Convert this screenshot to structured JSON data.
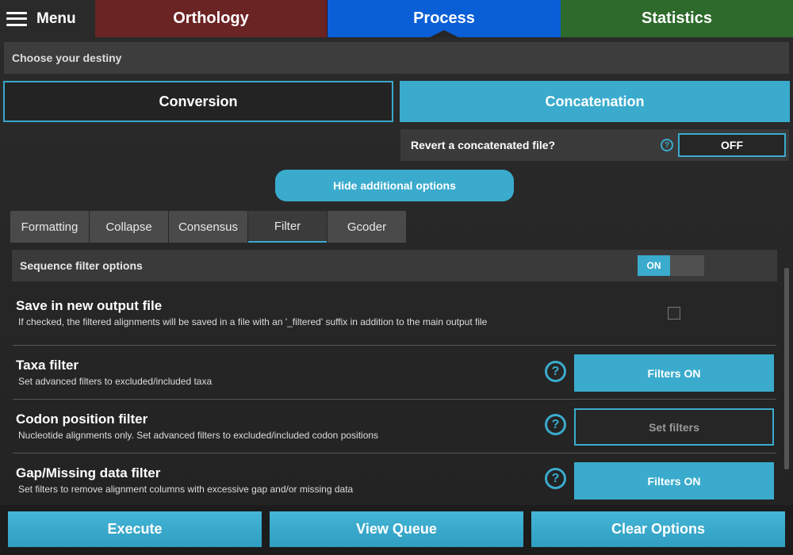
{
  "topbar": {
    "menu_label": "Menu",
    "tabs": [
      {
        "label": "Orthology",
        "color": "#6b2424"
      },
      {
        "label": "Process",
        "color": "#0a5fd6"
      },
      {
        "label": "Statistics",
        "color": "#2e6a2b"
      }
    ],
    "active_tab": "Process"
  },
  "destiny": {
    "label": "Choose your destiny"
  },
  "modes": {
    "conversion": "Conversion",
    "concatenation": "Concatenation",
    "selected": "Concatenation"
  },
  "revert": {
    "label": "Revert a concatenated file?",
    "help_icon": "?",
    "value": "OFF"
  },
  "hide_options_label": "Hide additional options",
  "subtabs": {
    "items": [
      "Formatting",
      "Collapse",
      "Consensus",
      "Filter",
      "Gcoder"
    ],
    "active": "Filter"
  },
  "sequence_filter": {
    "label": "Sequence filter options",
    "toggle": "ON"
  },
  "save_option": {
    "title": "Save in new output file",
    "description": "If checked, the filtered alignments will be saved in a file with an '_filtered' suffix in addition to the main output file",
    "checked": false
  },
  "filters": [
    {
      "title": "Taxa filter",
      "description": "Set advanced filters to excluded/included taxa",
      "help_icon": "?",
      "button": "Filters ON"
    },
    {
      "title": "Codon position filter",
      "description": "Nucleotide alignments only. Set advanced filters to excluded/included codon positions",
      "help_icon": "?",
      "button": "Set filters"
    },
    {
      "title": "Gap/Missing data filter",
      "description": "Set filters to remove alignment columns with excessive gap and/or missing data",
      "help_icon": "?",
      "button": "Filters ON"
    }
  ],
  "bottom": {
    "execute": "Execute",
    "view_queue": "View Queue",
    "clear_options": "Clear Options"
  },
  "colors": {
    "accent": "#3aabcd",
    "background": "#262626"
  }
}
